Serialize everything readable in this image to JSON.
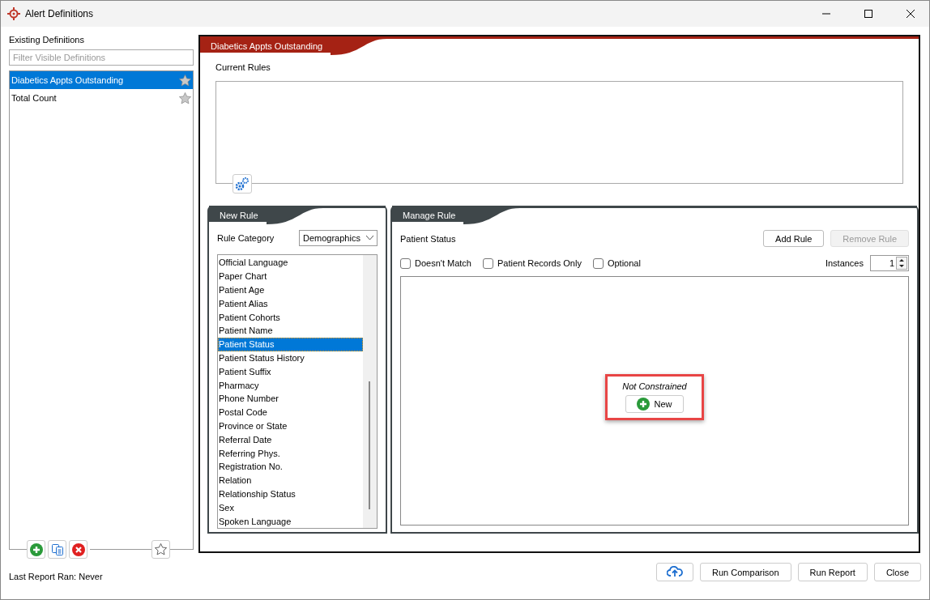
{
  "window": {
    "title": "Alert Definitions"
  },
  "sidebar": {
    "heading": "Existing Definitions",
    "filter_placeholder": "Filter Visible Definitions",
    "items": [
      {
        "label": "Diabetics Appts Outstanding",
        "selected": true
      },
      {
        "label": "Total Count",
        "selected": false
      }
    ]
  },
  "last_report": "Last Report Ran: Never",
  "definition": {
    "title": "Diabetics Appts Outstanding",
    "current_rules_label": "Current Rules"
  },
  "new_rule": {
    "title": "New Rule",
    "category_label": "Rule Category",
    "category_value": "Demographics",
    "items": [
      {
        "label": "Official Language",
        "selected": false
      },
      {
        "label": "Paper Chart",
        "selected": false
      },
      {
        "label": "Patient Age",
        "selected": false
      },
      {
        "label": "Patient Alias",
        "selected": false
      },
      {
        "label": "Patient Cohorts",
        "selected": false
      },
      {
        "label": "Patient Name",
        "selected": false
      },
      {
        "label": "Patient Status",
        "selected": true
      },
      {
        "label": "Patient Status History",
        "selected": false
      },
      {
        "label": "Patient Suffix",
        "selected": false
      },
      {
        "label": "Pharmacy",
        "selected": false
      },
      {
        "label": "Phone Number",
        "selected": false
      },
      {
        "label": "Postal Code",
        "selected": false
      },
      {
        "label": "Province or State",
        "selected": false
      },
      {
        "label": "Referral Date",
        "selected": false
      },
      {
        "label": "Referring Phys.",
        "selected": false
      },
      {
        "label": "Registration No.",
        "selected": false
      },
      {
        "label": "Relation",
        "selected": false
      },
      {
        "label": "Relationship Status",
        "selected": false
      },
      {
        "label": "Sex",
        "selected": false
      },
      {
        "label": "Spoken Language",
        "selected": false
      }
    ]
  },
  "manage_rule": {
    "title": "Manage Rule",
    "rule_name": "Patient Status",
    "buttons": [
      {
        "label": "Add Rule",
        "disabled": false
      },
      {
        "label": "Remove Rule",
        "disabled": true
      }
    ],
    "options": [
      {
        "label": "Doesn't Match",
        "checked": false
      },
      {
        "label": "Patient Records Only",
        "checked": false
      },
      {
        "label": "Optional",
        "checked": false
      }
    ],
    "instances_label": "Instances",
    "instances_value": "1",
    "empty_text": "Not Constrained",
    "new_button": "New"
  },
  "footer_buttons": [
    "Run Comparison",
    "Run Report",
    "Close"
  ]
}
